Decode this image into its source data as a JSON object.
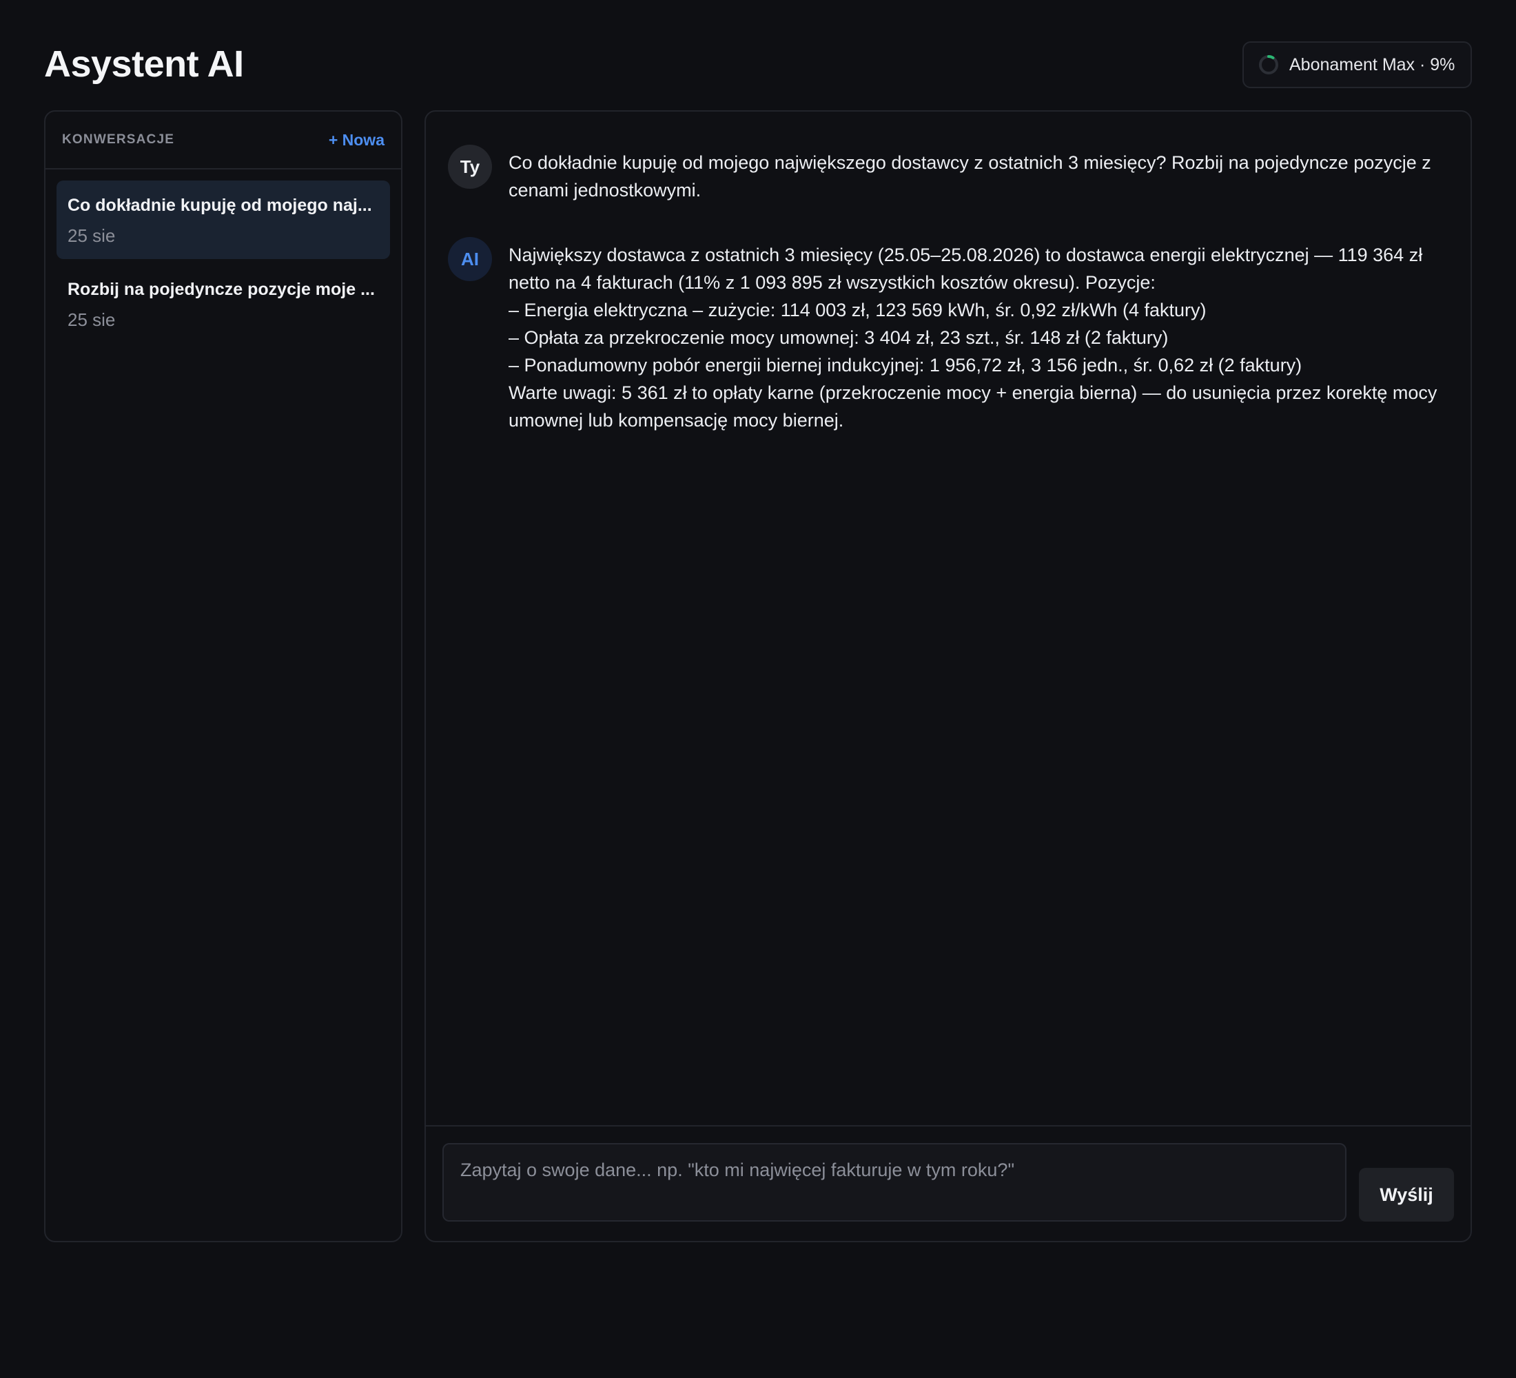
{
  "header": {
    "title": "Asystent AI",
    "plan": {
      "label": "Abonament Max · 9%",
      "usage_fraction": 0.09,
      "ring_color": "#2bb673"
    }
  },
  "sidebar": {
    "heading": "KONWERSACJE",
    "new_label": "+ Nowa",
    "conversations": [
      {
        "title": "Co dokładnie kupuję od mojego naj...",
        "date": "25 sie",
        "active": true
      },
      {
        "title": "Rozbij na pojedyncze pozycje moje ...",
        "date": "25 sie",
        "active": false
      }
    ]
  },
  "chat": {
    "messages": [
      {
        "role": "user",
        "avatar": "Ty",
        "lines": [
          "Co dokładnie kupuję od mojego największego dostawcy z ostatnich 3 miesięcy? Rozbij na pojedyncze pozycje z cenami jednostkowymi."
        ]
      },
      {
        "role": "ai",
        "avatar": "AI",
        "lines": [
          "Największy dostawca z ostatnich 3 miesięcy (25.05–25.08.2026) to dostawca energii elektrycznej — 119 364 zł netto na 4 fakturach (11% z 1 093 895 zł wszystkich kosztów okresu). Pozycje:",
          "– Energia elektryczna – zużycie: 114 003 zł, 123 569 kWh, śr. 0,92 zł/kWh (4 faktury)",
          "– Opłata za przekroczenie mocy umownej: 3 404 zł, 23 szt., śr. 148 zł (2 faktury)",
          "– Ponadumowny pobór energii biernej indukcyjnej: 1 956,72 zł, 3 156 jedn., śr. 0,62 zł (2 faktury)",
          "Warte uwagi: 5 361 zł to opłaty karne (przekroczenie mocy + energia bierna) — do usunięcia przez korektę mocy umownej lub kompensację mocy biernej."
        ]
      }
    ],
    "input_placeholder": "Zapytaj o swoje dane... np. \"kto mi najwięcej fakturuje w tym roku?\"",
    "input_value": "",
    "send_label": "Wyślij"
  }
}
